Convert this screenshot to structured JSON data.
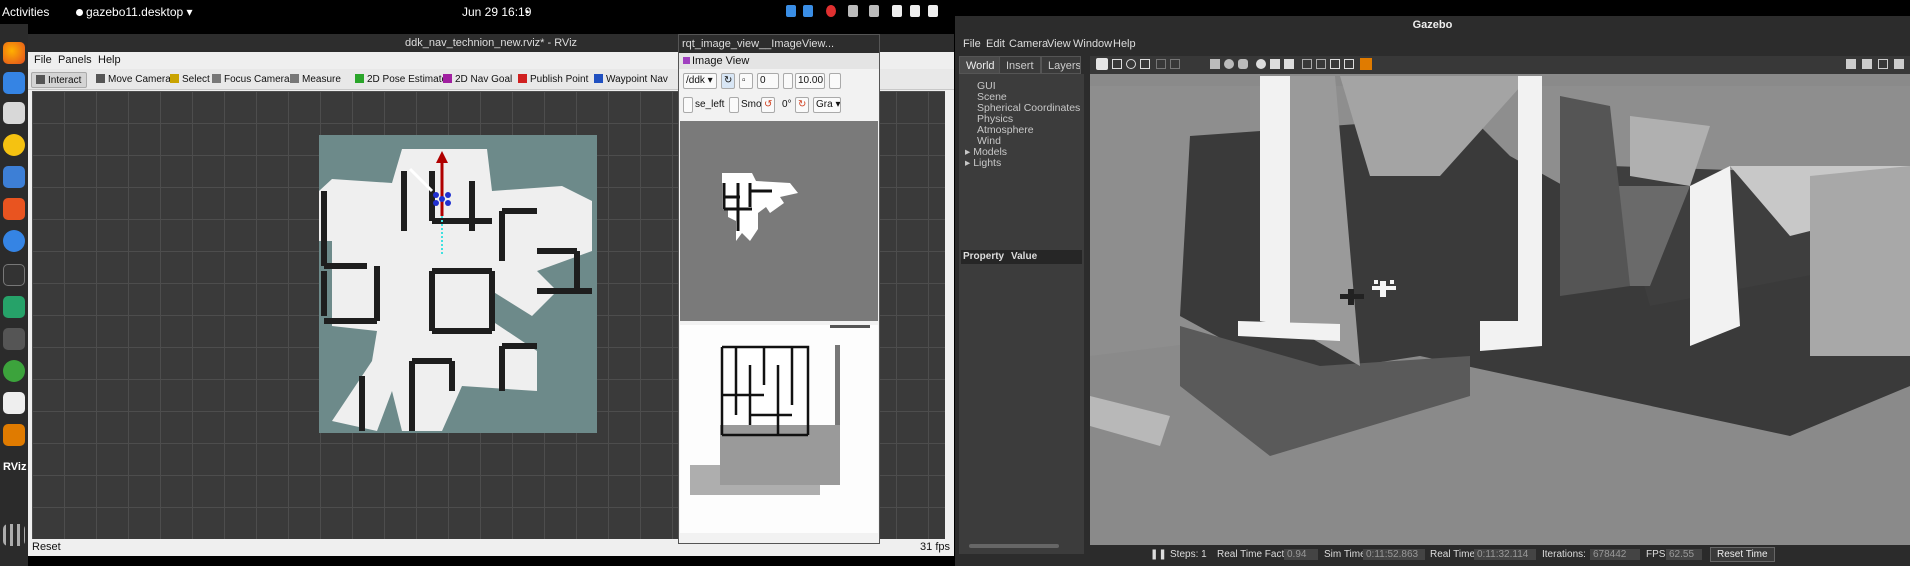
{
  "topbar": {
    "activities": "Activities",
    "app_menu": "gazebo11.desktop",
    "clock": "Jun 29  16:19",
    "indicator_dot": "•"
  },
  "rviz": {
    "title": "ddk_nav_technion_new.rviz* - RViz",
    "menu": [
      "File",
      "Panels",
      "Help"
    ],
    "tools": [
      {
        "label": "Interact",
        "icon": "interact-icon",
        "color": "#555"
      },
      {
        "label": "Move Camera",
        "icon": "move-camera-icon",
        "color": "#555"
      },
      {
        "label": "Select",
        "icon": "select-icon",
        "color": "#c9a300"
      },
      {
        "label": "Focus Camera",
        "icon": "focus-camera-icon",
        "color": "#777"
      },
      {
        "label": "Measure",
        "icon": "measure-icon",
        "color": "#777"
      },
      {
        "label": "2D Pose Estimate",
        "icon": "pose-estimate-icon",
        "color": "#2aa52a"
      },
      {
        "label": "2D Nav Goal",
        "icon": "nav-goal-icon",
        "color": "#a020a0"
      },
      {
        "label": "Publish Point",
        "icon": "publish-point-icon",
        "color": "#d02020"
      },
      {
        "label": "Waypoint Nav",
        "icon": "waypoint-nav-icon",
        "color": "#2050c0"
      }
    ],
    "status_reset": "Reset",
    "fps": "31 fps"
  },
  "rqt": {
    "title": "rqt_image_view__ImageView...",
    "subtitle": "Image View",
    "topic": "/ddk",
    "value1": "0",
    "value2": "10.00",
    "checkbox1_label": "se_left",
    "checkbox2_label": "Smo",
    "rotation": "0°",
    "color_scheme": "Gra"
  },
  "gazebo": {
    "title": "Gazebo",
    "menu": [
      "File",
      "Edit",
      "Camera",
      "View",
      "Window",
      "Help"
    ],
    "tabs": [
      "World",
      "Insert",
      "Layers"
    ],
    "tree": [
      "GUI",
      "Scene",
      "Spherical Coordinates",
      "Physics",
      "Atmosphere",
      "Wind",
      "Models",
      "Lights"
    ],
    "property_header": [
      "Property",
      "Value"
    ],
    "bottom": {
      "steps_label": "Steps: 1",
      "rtf_label": "Real Time Factor:",
      "rtf": "0.94",
      "sim_time_label": "Sim Time:",
      "sim_time": "0:11:52.863",
      "real_time_label": "Real Time:",
      "real_time": "0:11:32.114",
      "iterations_label": "Iterations:",
      "iterations": "678442",
      "fps_label": "FPS:",
      "fps": "62.55",
      "reset_time": "Reset Time"
    }
  },
  "colors": {
    "map_unknown": "#6d8a8a",
    "map_free": "#efefef",
    "wall": "#1e1e1e",
    "robot_arrow": "#b00000",
    "path": "#40e0e0"
  }
}
